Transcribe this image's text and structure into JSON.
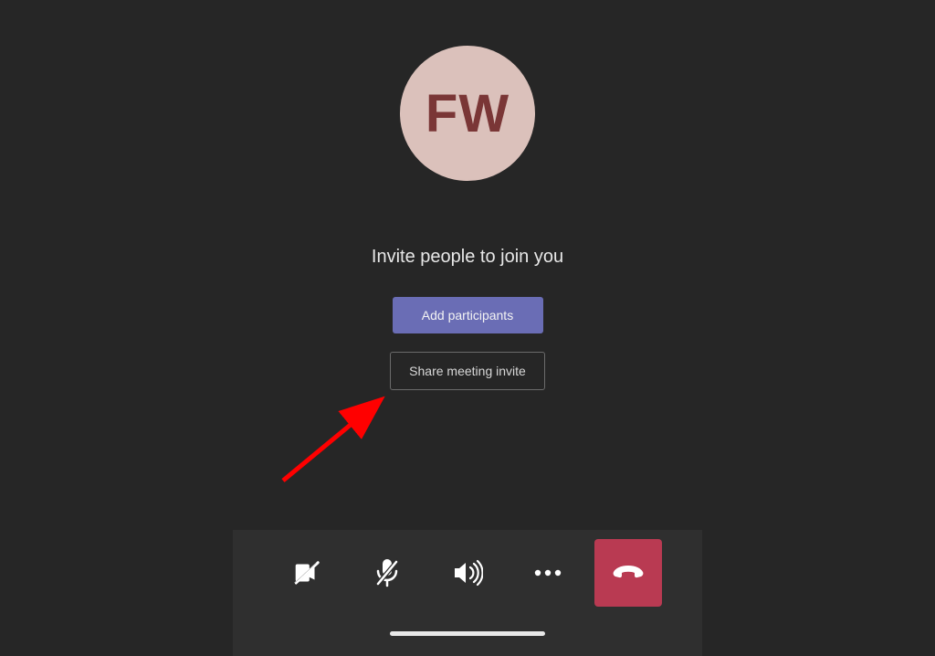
{
  "avatar": {
    "initials": "FW",
    "bg_color": "#dbc1bb",
    "text_color": "#7a3636"
  },
  "invite": {
    "heading": "Invite people to join you",
    "add_participants_label": "Add participants",
    "share_invite_label": "Share meeting invite"
  },
  "controls": {
    "camera": "camera-off",
    "mic": "mic-off",
    "speaker": "speaker",
    "more": "more-options",
    "hangup": "hang-up"
  },
  "colors": {
    "accent": "#6a6db5",
    "danger": "#b93a52",
    "background": "#262626",
    "panel": "#2f2f2f"
  },
  "annotation": {
    "arrow_color": "#ff0000"
  }
}
